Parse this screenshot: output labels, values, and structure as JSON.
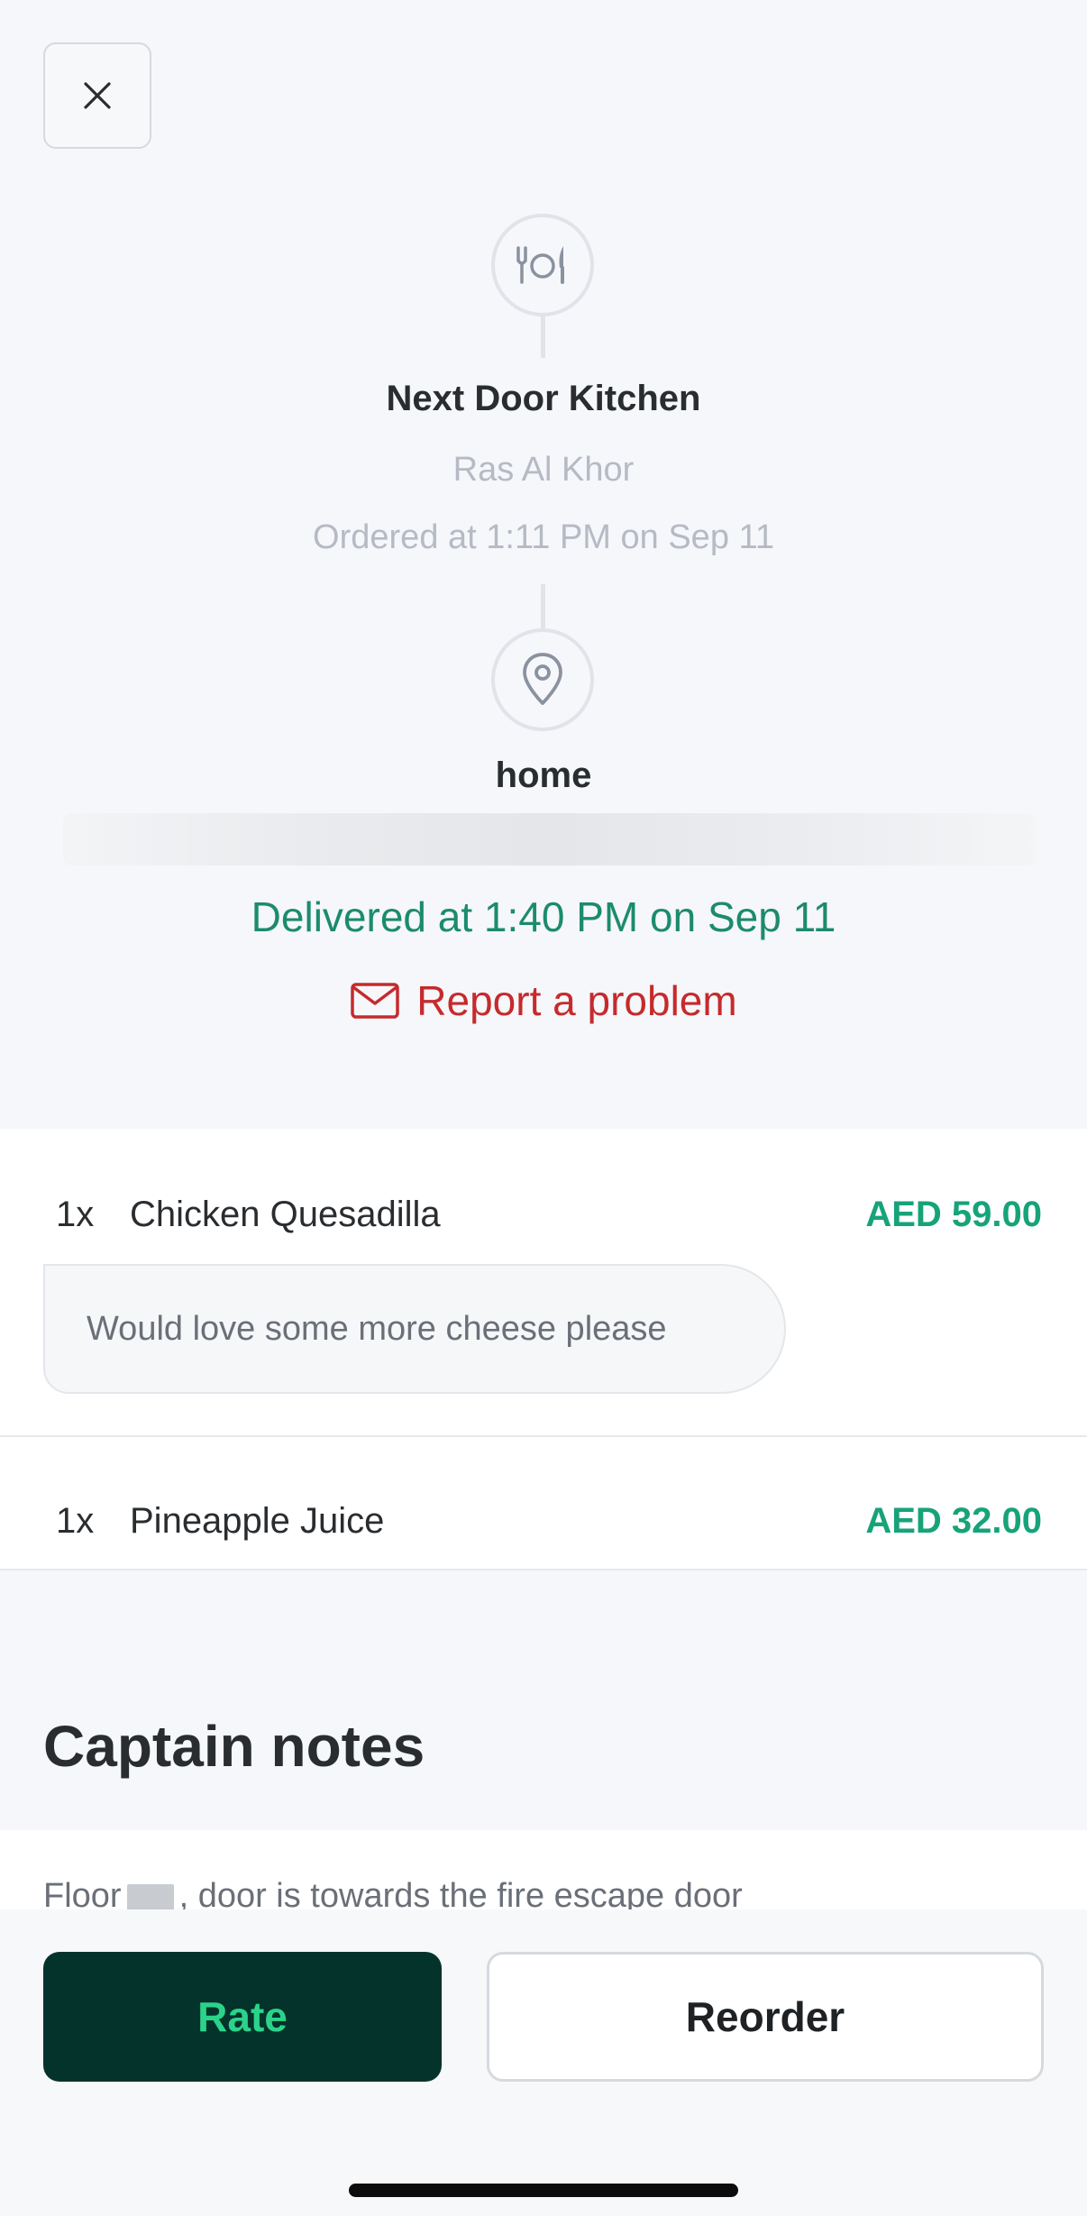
{
  "header": {
    "close_icon": "close-icon"
  },
  "route": {
    "restaurant": {
      "icon": "cutlery-icon",
      "name": "Next Door Kitchen",
      "area": "Ras Al Khor",
      "ordered_at": "Ordered at 1:11 PM on Sep 11"
    },
    "destination": {
      "icon": "location-pin-icon",
      "label": "home"
    },
    "delivered_at": "Delivered at 1:40 PM on Sep 11",
    "report": {
      "icon": "mail-icon",
      "label": "Report a problem"
    }
  },
  "items": [
    {
      "qty": "1x",
      "name": "Chicken Quesadilla",
      "price": "AED 59.00",
      "note": "Would love some more cheese please"
    },
    {
      "qty": "1x",
      "name": "Pineapple Juice",
      "price": "AED 32.00"
    }
  ],
  "captain_notes": {
    "title": "Captain notes",
    "text_before": "Floor",
    "text_after": ", door is towards the fire escape door"
  },
  "actions": {
    "rate_label": "Rate",
    "reorder_label": "Reorder"
  },
  "colors": {
    "accent_green": "#17a37a",
    "delivered_green": "#1c8b6e",
    "danger_red": "#c62a2d",
    "rate_bg": "#04332b",
    "rate_text": "#2bd38a"
  }
}
